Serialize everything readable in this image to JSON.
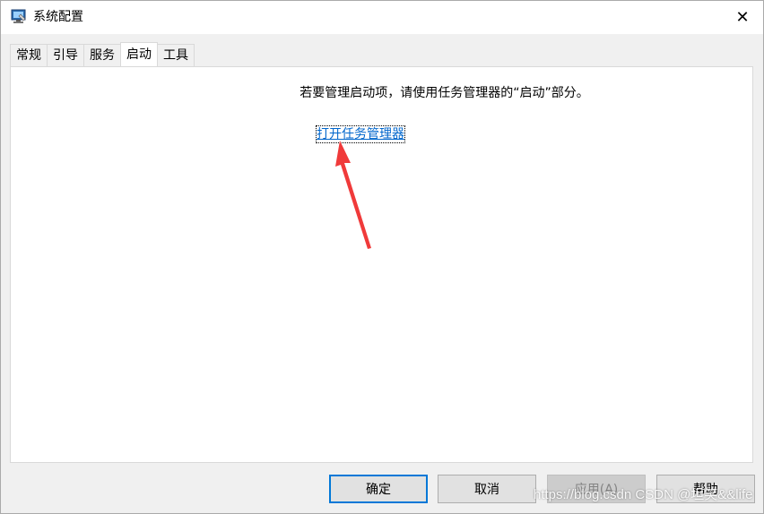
{
  "window": {
    "title": "系统配置",
    "close_glyph": "✕"
  },
  "tabs": [
    {
      "label": "常规",
      "selected": false
    },
    {
      "label": "引导",
      "selected": false
    },
    {
      "label": "服务",
      "selected": false
    },
    {
      "label": "启动",
      "selected": true
    },
    {
      "label": "工具",
      "selected": false
    }
  ],
  "startup": {
    "instruction": "若要管理启动项，请使用任务管理器的“启动”部分。",
    "link_label": "打开任务管理器"
  },
  "buttons": {
    "ok": "确定",
    "cancel": "取消",
    "apply": "应用(A)",
    "help": "帮助"
  },
  "watermark": "https://blog.csdn CSDN @坦笑&&life",
  "colors": {
    "accent": "#0078d7",
    "link": "#0066cc",
    "annotation_arrow": "#f03a3a"
  }
}
